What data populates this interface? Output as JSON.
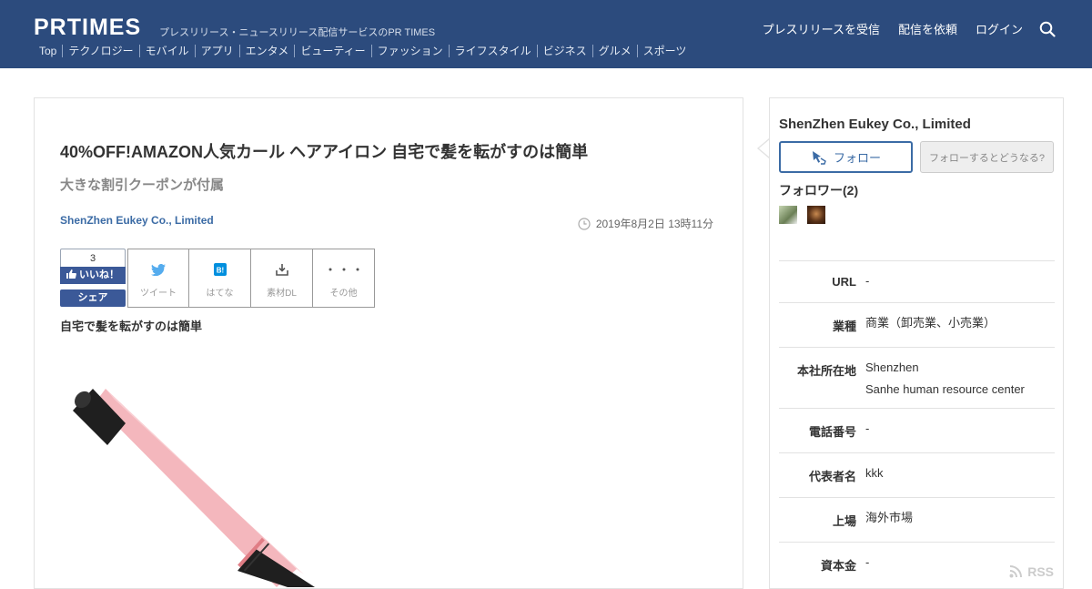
{
  "header": {
    "logo": "PRTIMES",
    "tagline": "プレスリリース・ニュースリリース配信サービスのPR TIMES",
    "nav": [
      "プレスリリースを受信",
      "配信を依頼",
      "ログイン"
    ],
    "categories": [
      "Top",
      "テクノロジー",
      "モバイル",
      "アプリ",
      "エンタメ",
      "ビューティー",
      "ファッション",
      "ライフスタイル",
      "ビジネス",
      "グルメ",
      "スポーツ"
    ]
  },
  "article": {
    "title": "40%OFF!AMAZON人気カール ヘアアイロン 自宅で髪を転がすのは簡単",
    "subtitle": "大きな割引クーポンが付属",
    "company": "ShenZhen Eukey Co., Limited",
    "date": "2019年8月2日 13時11分",
    "lead": "自宅で髪を転がすのは簡単"
  },
  "social": {
    "like_count": "3",
    "like_label": "いいね！",
    "share_label": "シェア",
    "buttons": [
      "ツイート",
      "はてな",
      "素材DL",
      "その他"
    ]
  },
  "sidebar": {
    "company": "ShenZhen Eukey Co., Limited",
    "follow_label": "フォロー",
    "whatif_label": "フォローするとどうなる?",
    "followers_label": "フォロワー(2)",
    "info": [
      {
        "key": "URL",
        "value": "-"
      },
      {
        "key": "業種",
        "value": "商業（卸売業、小売業）"
      },
      {
        "key": "本社所在地",
        "value": "Shenzhen",
        "value2": "Sanhe human resource center"
      },
      {
        "key": "電話番号",
        "value": "-"
      },
      {
        "key": "代表者名",
        "value": "kkk"
      },
      {
        "key": "上場",
        "value": "海外市場"
      },
      {
        "key": "資本金",
        "value": "-"
      }
    ],
    "rss_label": "RSS"
  },
  "colors": {
    "header_bg": "#2c4b7d",
    "link": "#3b6ba5",
    "facebook": "#3b5998",
    "twitter": "#55acee",
    "hatena": "#008fde"
  }
}
